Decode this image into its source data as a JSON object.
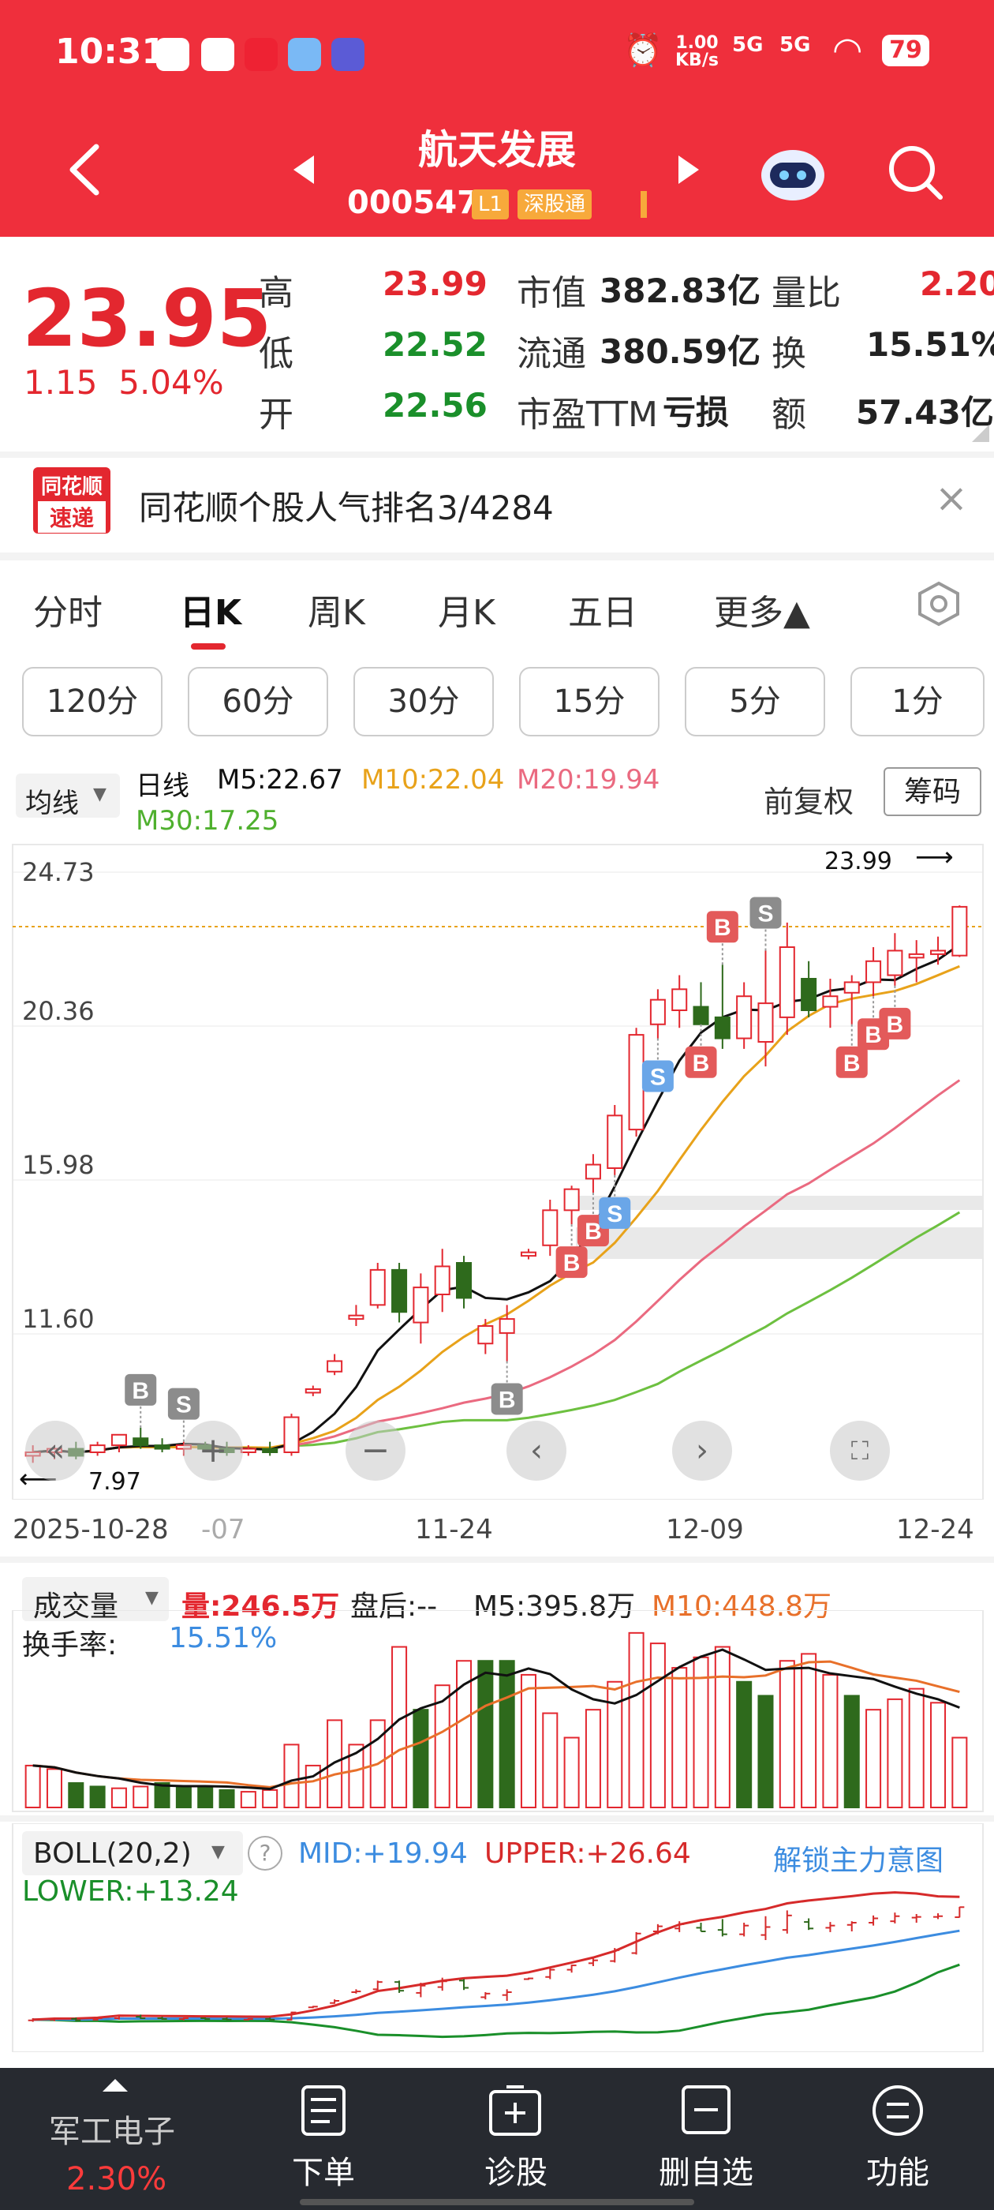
{
  "status_bar": {
    "time": "10:31",
    "speed": "1.00",
    "speed_unit": "KB/s",
    "net1": "5G",
    "net2": "5G",
    "battery": "79"
  },
  "header": {
    "title": "航天发展",
    "code": "000547",
    "tag_l1": "L1",
    "tag_market": "深股通"
  },
  "quote": {
    "price": "23.95",
    "change": "1.15",
    "change_pct": "5.04%",
    "rows": [
      {
        "l1": "高",
        "v1": "23.99",
        "l2": "市值",
        "v2": "382.83亿",
        "l3": "量比",
        "v3": "2.20"
      },
      {
        "l1": "低",
        "v1": "22.52",
        "l2": "流通",
        "v2": "380.59亿",
        "l3": "换",
        "v3": "15.51%"
      },
      {
        "l1": "开",
        "v1": "22.56",
        "l2": "市盈TTM",
        "v2": "亏损",
        "l3": "额",
        "v3": "57.43亿"
      }
    ]
  },
  "banner": {
    "logo_line1": "同花顺",
    "logo_line2": "速递",
    "text": "同花顺个股人气排名3/4284",
    "close": "×"
  },
  "tabs": [
    "分时",
    "日K",
    "周K",
    "月K",
    "五日",
    "更多▲"
  ],
  "periods": [
    "120分",
    "60分",
    "30分",
    "15分",
    "5分",
    "1分"
  ],
  "kline_legend": {
    "ma_btn": "均线",
    "kind": "日线",
    "m5": "M5:22.67",
    "m10": "M10:22.04",
    "m20": "M20:19.94",
    "m30": "M30:17.25",
    "adjust": "前复权",
    "chips": "筹码"
  },
  "kline_axis": {
    "y_labels": [
      "24.73",
      "20.36",
      "15.98",
      "11.60"
    ],
    "high_mark": "23.99",
    "low_mark": "7.97",
    "dates": [
      "2025-10-28",
      "-07",
      "11-24",
      "12-09",
      "12-24"
    ]
  },
  "volume_legend": {
    "name": "成交量",
    "vol": "量:246.5万",
    "after": "盘后:--",
    "m5": "M5:395.8万",
    "m10": "M10:448.8万",
    "turnover_label": "换手率:",
    "turnover": "15.51%"
  },
  "boll_legend": {
    "name": "BOLL(20,2)",
    "mid": "MID:+19.94",
    "upper": "UPPER:+26.64",
    "lower": "LOWER:+13.24",
    "unlock": "解锁主力意图"
  },
  "bottom_nav": {
    "sector": "军工电子",
    "sector_pct": "2.30%",
    "items": [
      "下单",
      "诊股",
      "删自选",
      "功能"
    ]
  },
  "colors": {
    "header_red": "#ef2f3c",
    "up": "#e3272f",
    "down": "#2e6a1c",
    "ma5": "#111111",
    "ma10": "#e8a21a",
    "ma20": "#ea6a80",
    "ma30": "#6dc040",
    "boll_mid": "#3c8ce0"
  },
  "chart_data": {
    "type": "candlestick",
    "y_range": [
      7.5,
      25.5
    ],
    "candles": [
      {
        "o": 8.3,
        "h": 8.6,
        "l": 8.1,
        "c": 8.4
      },
      {
        "o": 8.4,
        "h": 8.6,
        "l": 8.2,
        "c": 8.5
      },
      {
        "o": 8.5,
        "h": 8.7,
        "l": 8.2,
        "c": 8.3
      },
      {
        "o": 8.4,
        "h": 8.7,
        "l": 8.3,
        "c": 8.6
      },
      {
        "o": 8.6,
        "h": 8.8,
        "l": 8.4,
        "c": 8.9
      },
      {
        "o": 8.8,
        "h": 9.1,
        "l": 8.5,
        "c": 8.6
      },
      {
        "o": 8.6,
        "h": 8.8,
        "l": 8.4,
        "c": 8.5
      },
      {
        "o": 8.5,
        "h": 8.7,
        "l": 8.3,
        "c": 8.6
      },
      {
        "o": 8.6,
        "h": 8.7,
        "l": 8.4,
        "c": 8.5
      },
      {
        "o": 8.5,
        "h": 8.7,
        "l": 8.3,
        "c": 8.4
      },
      {
        "o": 8.4,
        "h": 8.6,
        "l": 8.3,
        "c": 8.5
      },
      {
        "o": 8.5,
        "h": 8.7,
        "l": 8.3,
        "c": 8.4
      },
      {
        "o": 8.4,
        "h": 9.5,
        "l": 8.3,
        "c": 9.4
      },
      {
        "o": 10.1,
        "h": 10.3,
        "l": 10.0,
        "c": 10.2
      },
      {
        "o": 10.7,
        "h": 11.2,
        "l": 10.6,
        "c": 11.0
      },
      {
        "o": 12.2,
        "h": 12.6,
        "l": 12.0,
        "c": 12.3
      },
      {
        "o": 12.6,
        "h": 13.8,
        "l": 12.5,
        "c": 13.6
      },
      {
        "o": 13.6,
        "h": 13.8,
        "l": 12.1,
        "c": 12.4
      },
      {
        "o": 12.1,
        "h": 13.5,
        "l": 11.5,
        "c": 13.1
      },
      {
        "o": 12.9,
        "h": 14.2,
        "l": 12.4,
        "c": 13.7
      },
      {
        "o": 13.8,
        "h": 14.0,
        "l": 12.5,
        "c": 12.8
      },
      {
        "o": 11.5,
        "h": 12.2,
        "l": 11.2,
        "c": 12.0
      },
      {
        "o": 11.8,
        "h": 12.6,
        "l": 11.0,
        "c": 12.2
      },
      {
        "o": 14.0,
        "h": 14.2,
        "l": 13.9,
        "c": 14.1
      },
      {
        "o": 14.3,
        "h": 15.6,
        "l": 14.0,
        "c": 15.3
      },
      {
        "o": 15.3,
        "h": 16.0,
        "l": 14.9,
        "c": 15.9
      },
      {
        "o": 16.2,
        "h": 16.9,
        "l": 15.8,
        "c": 16.6
      },
      {
        "o": 16.5,
        "h": 18.3,
        "l": 16.3,
        "c": 18.0
      },
      {
        "o": 17.6,
        "h": 20.5,
        "l": 17.4,
        "c": 20.3
      },
      {
        "o": 20.6,
        "h": 21.6,
        "l": 20.2,
        "c": 21.3
      },
      {
        "o": 21.0,
        "h": 22.0,
        "l": 20.5,
        "c": 21.6
      },
      {
        "o": 21.1,
        "h": 21.8,
        "l": 20.6,
        "c": 20.6
      },
      {
        "o": 20.8,
        "h": 22.3,
        "l": 19.9,
        "c": 20.2
      },
      {
        "o": 20.2,
        "h": 21.8,
        "l": 19.9,
        "c": 21.4
      },
      {
        "o": 20.1,
        "h": 22.7,
        "l": 19.4,
        "c": 21.2
      },
      {
        "o": 20.8,
        "h": 23.5,
        "l": 20.3,
        "c": 22.8
      },
      {
        "o": 21.9,
        "h": 22.4,
        "l": 20.8,
        "c": 21.0
      },
      {
        "o": 21.1,
        "h": 21.9,
        "l": 20.5,
        "c": 21.4
      },
      {
        "o": 21.5,
        "h": 22.0,
        "l": 20.6,
        "c": 21.8
      },
      {
        "o": 21.8,
        "h": 22.8,
        "l": 21.4,
        "c": 22.4
      },
      {
        "o": 22.0,
        "h": 23.2,
        "l": 21.7,
        "c": 22.7
      },
      {
        "o": 22.5,
        "h": 23.0,
        "l": 21.8,
        "c": 22.6
      },
      {
        "o": 22.6,
        "h": 23.1,
        "l": 22.3,
        "c": 22.7
      },
      {
        "o": 22.56,
        "h": 23.99,
        "l": 22.52,
        "c": 23.95
      }
    ],
    "markers": [
      {
        "i": 5,
        "type": "B",
        "pos": "above"
      },
      {
        "i": 7,
        "type": "S",
        "pos": "above"
      },
      {
        "i": 22,
        "type": "B",
        "pos": "below"
      },
      {
        "i": 25,
        "type": "B",
        "pos": "below"
      },
      {
        "i": 26,
        "type": "B",
        "pos": "below"
      },
      {
        "i": 27,
        "type": "S",
        "pos": "below"
      },
      {
        "i": 29,
        "type": "S",
        "pos": "below"
      },
      {
        "i": 31,
        "type": "B",
        "pos": "below"
      },
      {
        "i": 32,
        "type": "B",
        "pos": "above"
      },
      {
        "i": 34,
        "type": "S",
        "pos": "above"
      },
      {
        "i": 38,
        "type": "B",
        "pos": "below"
      },
      {
        "i": 39,
        "type": "B",
        "pos": "below"
      },
      {
        "i": 40,
        "type": "B",
        "pos": "below"
      }
    ],
    "volumes": [
      {
        "v": 120,
        "up": true
      },
      {
        "v": 110,
        "up": true
      },
      {
        "v": 70,
        "up": false
      },
      {
        "v": 60,
        "up": false
      },
      {
        "v": 55,
        "up": true
      },
      {
        "v": 60,
        "up": true
      },
      {
        "v": 70,
        "up": false
      },
      {
        "v": 60,
        "up": false
      },
      {
        "v": 60,
        "up": false
      },
      {
        "v": 50,
        "up": false
      },
      {
        "v": 45,
        "up": true
      },
      {
        "v": 50,
        "up": true
      },
      {
        "v": 180,
        "up": true
      },
      {
        "v": 120,
        "up": true
      },
      {
        "v": 250,
        "up": true
      },
      {
        "v": 180,
        "up": true
      },
      {
        "v": 250,
        "up": true
      },
      {
        "v": 460,
        "up": true
      },
      {
        "v": 280,
        "up": false
      },
      {
        "v": 350,
        "up": true
      },
      {
        "v": 420,
        "up": true
      },
      {
        "v": 420,
        "up": false
      },
      {
        "v": 420,
        "up": false
      },
      {
        "v": 380,
        "up": true
      },
      {
        "v": 270,
        "up": true
      },
      {
        "v": 200,
        "up": true
      },
      {
        "v": 280,
        "up": true
      },
      {
        "v": 360,
        "up": true
      },
      {
        "v": 500,
        "up": true
      },
      {
        "v": 470,
        "up": true
      },
      {
        "v": 400,
        "up": true
      },
      {
        "v": 430,
        "up": true
      },
      {
        "v": 460,
        "up": true
      },
      {
        "v": 360,
        "up": false
      },
      {
        "v": 320,
        "up": false
      },
      {
        "v": 420,
        "up": true
      },
      {
        "v": 440,
        "up": true
      },
      {
        "v": 380,
        "up": true
      },
      {
        "v": 320,
        "up": false
      },
      {
        "v": 280,
        "up": true
      },
      {
        "v": 310,
        "up": true
      },
      {
        "v": 340,
        "up": true
      },
      {
        "v": 300,
        "up": true
      },
      {
        "v": 200,
        "up": true
      }
    ]
  }
}
